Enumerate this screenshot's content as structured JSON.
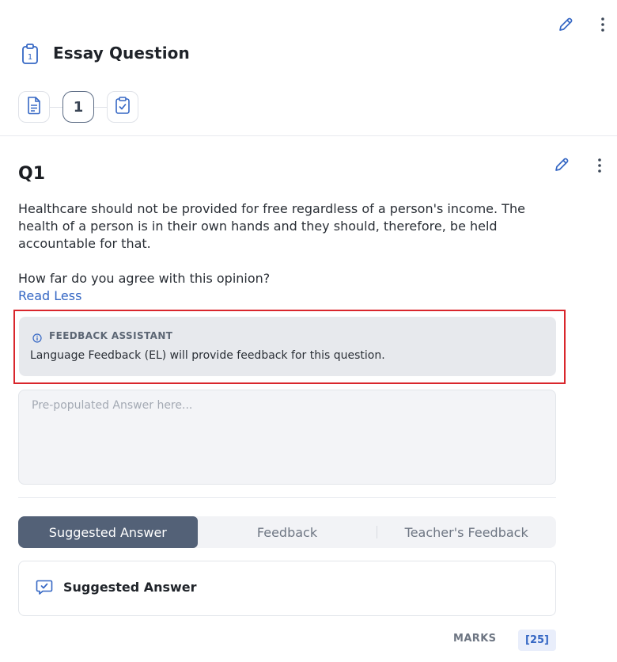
{
  "header": {
    "title": "Essay Question",
    "icon": "clipboard-number-icon",
    "clipboard_number": "1"
  },
  "stepper": {
    "steps": [
      {
        "type": "document-icon"
      },
      {
        "label": "1"
      },
      {
        "type": "clipboard-check-icon"
      }
    ]
  },
  "question": {
    "title": "Q1",
    "paragraph_1": "Healthcare should not be provided for free regardless of a person's income. The health of a person is in their own hands and they should, therefore, be held accountable for that.",
    "paragraph_2": "How far do you agree with this opinion?",
    "read_less": "Read Less"
  },
  "feedback_assistant": {
    "title": "FEEDBACK ASSISTANT",
    "text": "Language Feedback (EL) will provide feedback for this question."
  },
  "answer": {
    "placeholder": "Pre-populated Answer here...",
    "value": ""
  },
  "tabs": [
    {
      "label": "Suggested Answer",
      "active": true
    },
    {
      "label": "Feedback",
      "active": false
    },
    {
      "label": "Teacher's Feedback",
      "active": false
    }
  ],
  "suggested_answer": {
    "title": "Suggested Answer",
    "icon": "chat-check-icon"
  },
  "marks": {
    "label": "MARKS",
    "value": "[25]"
  },
  "colors": {
    "accent": "#3567c4",
    "tab_active": "#536177",
    "highlight": "#d9262c",
    "assistant_bg": "#e7e9ed"
  }
}
